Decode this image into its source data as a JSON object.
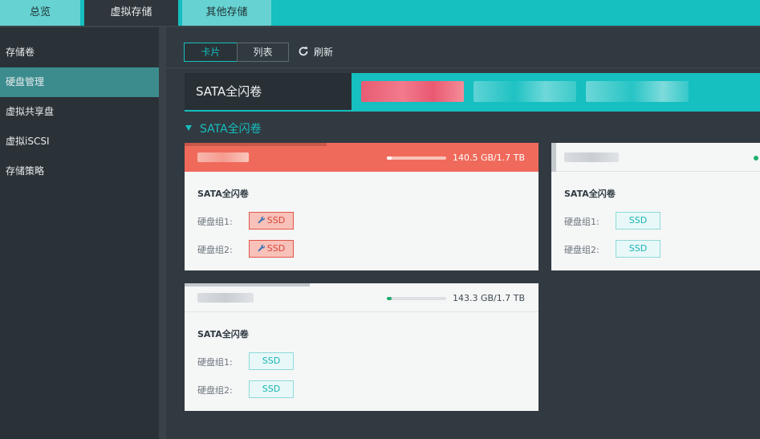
{
  "top_tabs": [
    "总览",
    "虚拟存储",
    "其他存储"
  ],
  "sidebar": {
    "items": [
      "存储卷",
      "硬盘管理",
      "虚拟共享盘",
      "虚拟iSCSI",
      "存储策略"
    ]
  },
  "toolbar": {
    "card_label": "卡片",
    "list_label": "列表",
    "refresh_label": "刷新"
  },
  "volume_tabs": {
    "active": "SATA全闪卷"
  },
  "section": {
    "title": "SATA全闪卷"
  },
  "cards": [
    {
      "usage": "140.5 GB/1.7 TB",
      "usage_fraction": 0.08,
      "volume": "SATA全闪卷",
      "groups": [
        {
          "label": "硬盘组1:",
          "disk": "SSD"
        },
        {
          "label": "硬盘组2:",
          "disk": "SSD"
        }
      ]
    },
    {
      "usage": "143.3 GB/1.7 TB",
      "usage_fraction": 0.08,
      "volume": "SATA全闪卷",
      "groups": [
        {
          "label": "硬盘组1:",
          "disk": "SSD"
        },
        {
          "label": "硬盘组2:",
          "disk": "SSD"
        }
      ]
    },
    {
      "volume": "SATA全闪卷",
      "groups": [
        {
          "label": "硬盘组1:",
          "disk": "SSD"
        },
        {
          "label": "硬盘组2:",
          "disk": "SSD"
        }
      ]
    }
  ],
  "colors": {
    "accent": "#16bfc0",
    "alert": "#f06a5b",
    "ok": "#1fae6f"
  }
}
